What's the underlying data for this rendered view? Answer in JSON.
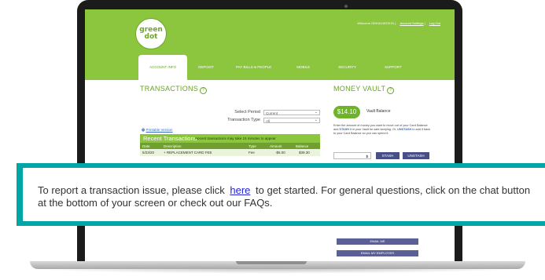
{
  "brand": {
    "logo_line1": "green",
    "logo_line2": "dot",
    "color": "#8cc63f"
  },
  "header": {
    "welcome": "Welcome GDKA14923191",
    "account_settings": "Account Settings",
    "log_out": "Log Out"
  },
  "nav": [
    "ACCOUNT INFO",
    "DEPOSIT",
    "PAY BILLS & PEOPLE",
    "MOBILE",
    "SECURITY",
    "SUPPORT"
  ],
  "transactions": {
    "title": "TRANSACTIONS",
    "select_period_label": "Select Period",
    "select_period_value": "Current",
    "transaction_type_label": "Transaction Type",
    "transaction_type_value": "All",
    "printable": "Printable Version",
    "recent_title": "Recent Transactions",
    "recent_note": "Recent transactions may take 15 minutes to appear",
    "columns": [
      "Date",
      "Description",
      "Type",
      "Amount",
      "Balance"
    ],
    "rows": [
      {
        "date": "5/23/20",
        "description": "+ REPLACEMENT CARD FEE",
        "type": "Fee",
        "amount": "-$5.00",
        "balance": "$39.30"
      }
    ]
  },
  "vault": {
    "title": "MONEY VAULT",
    "amount": "$14.10",
    "label": "Vault Balance",
    "description_1": "Enter the amount of money you want to move out of your Card Balance and",
    "stash_word": "STASH",
    "description_2": "it in your Vault for safe keeping. Or,",
    "unstash_word": "UNSTASH",
    "description_3": "to add it back to your Card Balance so you can spend it.",
    "input_value": "$",
    "stash_button": "STASH",
    "unstash_button": "UNSTASH"
  },
  "contact": {
    "email_me": "EMAIL ME",
    "email_employer": "EMAIL MY EMPLOYER"
  },
  "banner": {
    "text_before": "To report a transaction issue, please click",
    "link": "here",
    "text_after": "to get started. For general questions, click on the chat button at the bottom of your screen or check out our FAQs.",
    "border_color": "#00a6a6"
  }
}
